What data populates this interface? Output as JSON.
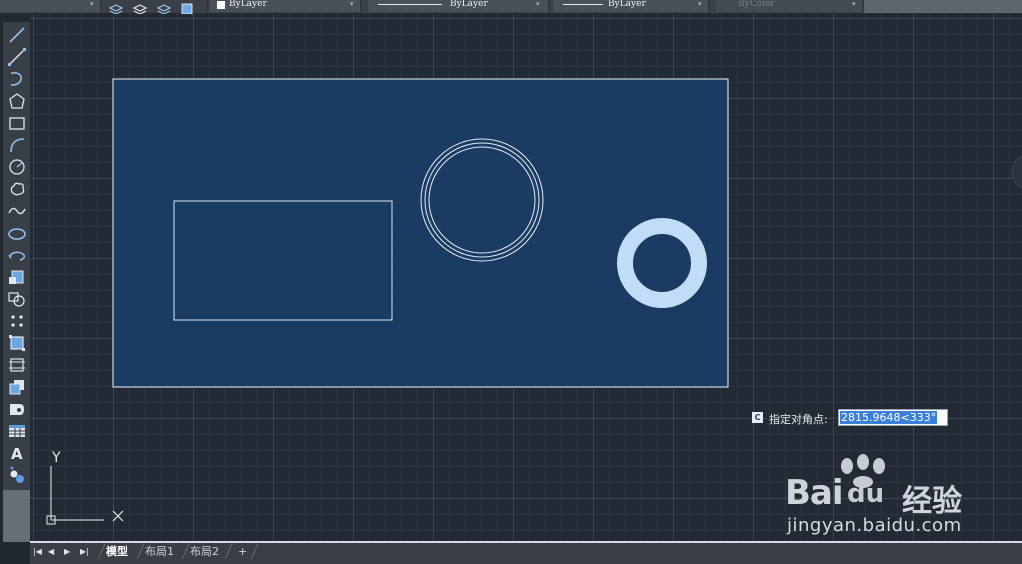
{
  "toolbar": {
    "layer_color_label": "ByLayer",
    "linetype_label": "ByLayer",
    "lineweight_label": "ByLayer",
    "plotstyle_label": "ByColor"
  },
  "command_prompt": {
    "icon_letter": "C",
    "label": "指定对角点:",
    "input_value": "2815.9648<333°"
  },
  "ucs": {
    "y_label": "Y"
  },
  "layout_tabs": [
    "模型",
    "布局1",
    "布局2",
    "+"
  ],
  "watermark": {
    "brand_latin": "Bai",
    "brand_du": "du",
    "brand_cn": "经验",
    "url": "jingyan.baidu.com"
  },
  "left_tools": [
    "line-icon",
    "construction-line-icon",
    "polyline-icon",
    "polygon-icon",
    "rectangle-icon",
    "arc-icon",
    "circle-icon",
    "revision-cloud-icon",
    "spline-icon",
    "ellipse-icon",
    "ellipse-arc-icon",
    "insert-block-icon",
    "make-block-icon",
    "point-icon",
    "hatch-icon",
    "gradient-icon",
    "region-icon",
    "wipeout-icon",
    "table-icon",
    "mtext-icon",
    "add-selected-icon"
  ],
  "colors": {
    "selection_fill": "#1a3d66",
    "drawing_line": "#e8eef5",
    "donut_fill": "#c0dcf7",
    "prompt_highlight": "#3b7fd6"
  }
}
